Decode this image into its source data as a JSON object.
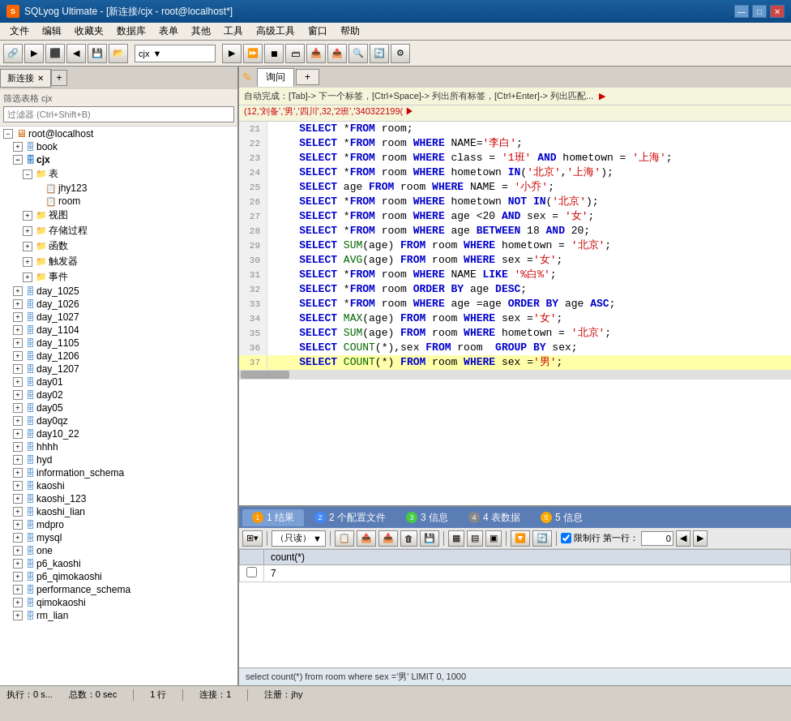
{
  "titleBar": {
    "icon": "S",
    "title": "SQLyog Ultimate - [新连接/cjx - root@localhost*]",
    "controls": [
      "—",
      "□",
      "✕"
    ]
  },
  "menuBar": {
    "items": [
      "文件",
      "编辑",
      "收藏夹",
      "数据库",
      "表单",
      "其他",
      "工具",
      "高级工具",
      "窗口",
      "帮助"
    ]
  },
  "toolbar": {
    "dropdown": "cjx"
  },
  "leftPanel": {
    "tabLabel": "新连接",
    "filterPlaceholder": "过滤器 (Ctrl+Shift+B)",
    "filterLabel": "筛选表格 cjx",
    "tree": [
      {
        "label": "root@localhost",
        "level": 0,
        "type": "root",
        "expanded": true
      },
      {
        "label": "book",
        "level": 1,
        "type": "db",
        "expanded": false
      },
      {
        "label": "cjx",
        "level": 1,
        "type": "db",
        "expanded": true
      },
      {
        "label": "表",
        "level": 2,
        "type": "folder",
        "expanded": true
      },
      {
        "label": "jhy123",
        "level": 3,
        "type": "table"
      },
      {
        "label": "room",
        "level": 3,
        "type": "table"
      },
      {
        "label": "视图",
        "level": 2,
        "type": "folder",
        "expanded": false
      },
      {
        "label": "存储过程",
        "level": 2,
        "type": "folder",
        "expanded": false
      },
      {
        "label": "函数",
        "level": 2,
        "type": "folder",
        "expanded": false
      },
      {
        "label": "触发器",
        "level": 2,
        "type": "folder",
        "expanded": false
      },
      {
        "label": "事件",
        "level": 2,
        "type": "folder",
        "expanded": false
      },
      {
        "label": "day_1025",
        "level": 1,
        "type": "db"
      },
      {
        "label": "day_1026",
        "level": 1,
        "type": "db"
      },
      {
        "label": "day_1027",
        "level": 1,
        "type": "db"
      },
      {
        "label": "day_1104",
        "level": 1,
        "type": "db"
      },
      {
        "label": "day_1105",
        "level": 1,
        "type": "db"
      },
      {
        "label": "day_1206",
        "level": 1,
        "type": "db"
      },
      {
        "label": "day_1207",
        "level": 1,
        "type": "db"
      },
      {
        "label": "day01",
        "level": 1,
        "type": "db"
      },
      {
        "label": "day02",
        "level": 1,
        "type": "db"
      },
      {
        "label": "day05",
        "level": 1,
        "type": "db"
      },
      {
        "label": "day0qz",
        "level": 1,
        "type": "db"
      },
      {
        "label": "day10_22",
        "level": 1,
        "type": "db"
      },
      {
        "label": "hhhh",
        "level": 1,
        "type": "db"
      },
      {
        "label": "hyd",
        "level": 1,
        "type": "db"
      },
      {
        "label": "information_schema",
        "level": 1,
        "type": "db"
      },
      {
        "label": "kaoshi",
        "level": 1,
        "type": "db"
      },
      {
        "label": "kaoshi_123",
        "level": 1,
        "type": "db"
      },
      {
        "label": "kaoshi_lian",
        "level": 1,
        "type": "db"
      },
      {
        "label": "mdpro",
        "level": 1,
        "type": "db"
      },
      {
        "label": "mysql",
        "level": 1,
        "type": "db"
      },
      {
        "label": "one",
        "level": 1,
        "type": "db"
      },
      {
        "label": "p6_kaoshi",
        "level": 1,
        "type": "db"
      },
      {
        "label": "p6_qimokaoshi",
        "level": 1,
        "type": "db"
      },
      {
        "label": "performance_schema",
        "level": 1,
        "type": "db"
      },
      {
        "label": "qimokaoshi",
        "level": 1,
        "type": "db"
      },
      {
        "label": "rm_lian",
        "level": 1,
        "type": "db"
      }
    ]
  },
  "rightPanel": {
    "tabs": [
      {
        "label": "询问",
        "active": true
      },
      {
        "label": "+",
        "active": false
      }
    ],
    "autocomplete": "自动完成：[Tab]-> 下一个标签，[Ctrl+Space]-> 列出所有标签，[Ctrl+Enter]-> 列出匹配...",
    "autocomplete2": "(12,'刘备','男','四川',32,'2班','340322199(",
    "sqlLines": [
      {
        "num": 21,
        "content": "    SELECT *FROM room;"
      },
      {
        "num": 22,
        "content": "    SELECT *FROM room WHERE NAME='李白';"
      },
      {
        "num": 23,
        "content": "    SELECT *FROM room WHERE class = '1班' AND hometown = '上海';"
      },
      {
        "num": 24,
        "content": "    SELECT *FROM room WHERE hometown IN('北京','上海');"
      },
      {
        "num": 25,
        "content": "    SELECT age FROM room WHERE NAME = '小乔';"
      },
      {
        "num": 26,
        "content": "    SELECT *FROM room WHERE hometown NOT IN('北京');"
      },
      {
        "num": 27,
        "content": "    SELECT *FROM room WHERE age <20 AND sex = '女';"
      },
      {
        "num": 28,
        "content": "    SELECT *FROM room WHERE age BETWEEN 18 AND 20;"
      },
      {
        "num": 29,
        "content": "    SELECT SUM(age) FROM room WHERE hometown = '北京';"
      },
      {
        "num": 30,
        "content": "    SELECT AVG(age) FROM room WHERE sex ='女';"
      },
      {
        "num": 31,
        "content": "    SELECT *FROM room WHERE NAME LIKE '%白%';"
      },
      {
        "num": 32,
        "content": "    SELECT *FROM room ORDER BY age DESC;"
      },
      {
        "num": 33,
        "content": "    SELECT *FROM room WHERE age =age ORDER BY age ASC;"
      },
      {
        "num": 34,
        "content": "    SELECT MAX(age) FROM room WHERE sex ='女';"
      },
      {
        "num": 35,
        "content": "    SELECT SUM(age) FROM room WHERE hometown = '北京';"
      },
      {
        "num": 36,
        "content": "    SELECT COUNT(*),sex FROM room  GROUP BY sex;"
      },
      {
        "num": 37,
        "content": "    SELECT COUNT(*) FROM room WHERE sex ='男';"
      }
    ],
    "resultsTabs": [
      {
        "icon": "1",
        "label": "1 结果",
        "active": true
      },
      {
        "icon": "2",
        "label": "2 个配置文件"
      },
      {
        "icon": "3",
        "label": "3 信息"
      },
      {
        "icon": "4",
        "label": "4 表数据"
      },
      {
        "icon": "5",
        "label": "5 信息"
      }
    ],
    "resultsToolbar": {
      "modeLabel": "（只读）",
      "limitCheckbox": "限制行 第一行：",
      "limitValue": "0"
    },
    "tableColumns": [
      "",
      "count(*)"
    ],
    "tableRows": [
      {
        "checkbox": false,
        "value": "7"
      }
    ],
    "sqlStatusBar": "select count(*) from room where sex ='男' LIMIT 0, 1000"
  },
  "statusBar": {
    "execution": "执行：0 s...",
    "total": "总数：0 sec",
    "rows": "1 行",
    "connection": "连接：1",
    "register": "注册：jhy"
  }
}
